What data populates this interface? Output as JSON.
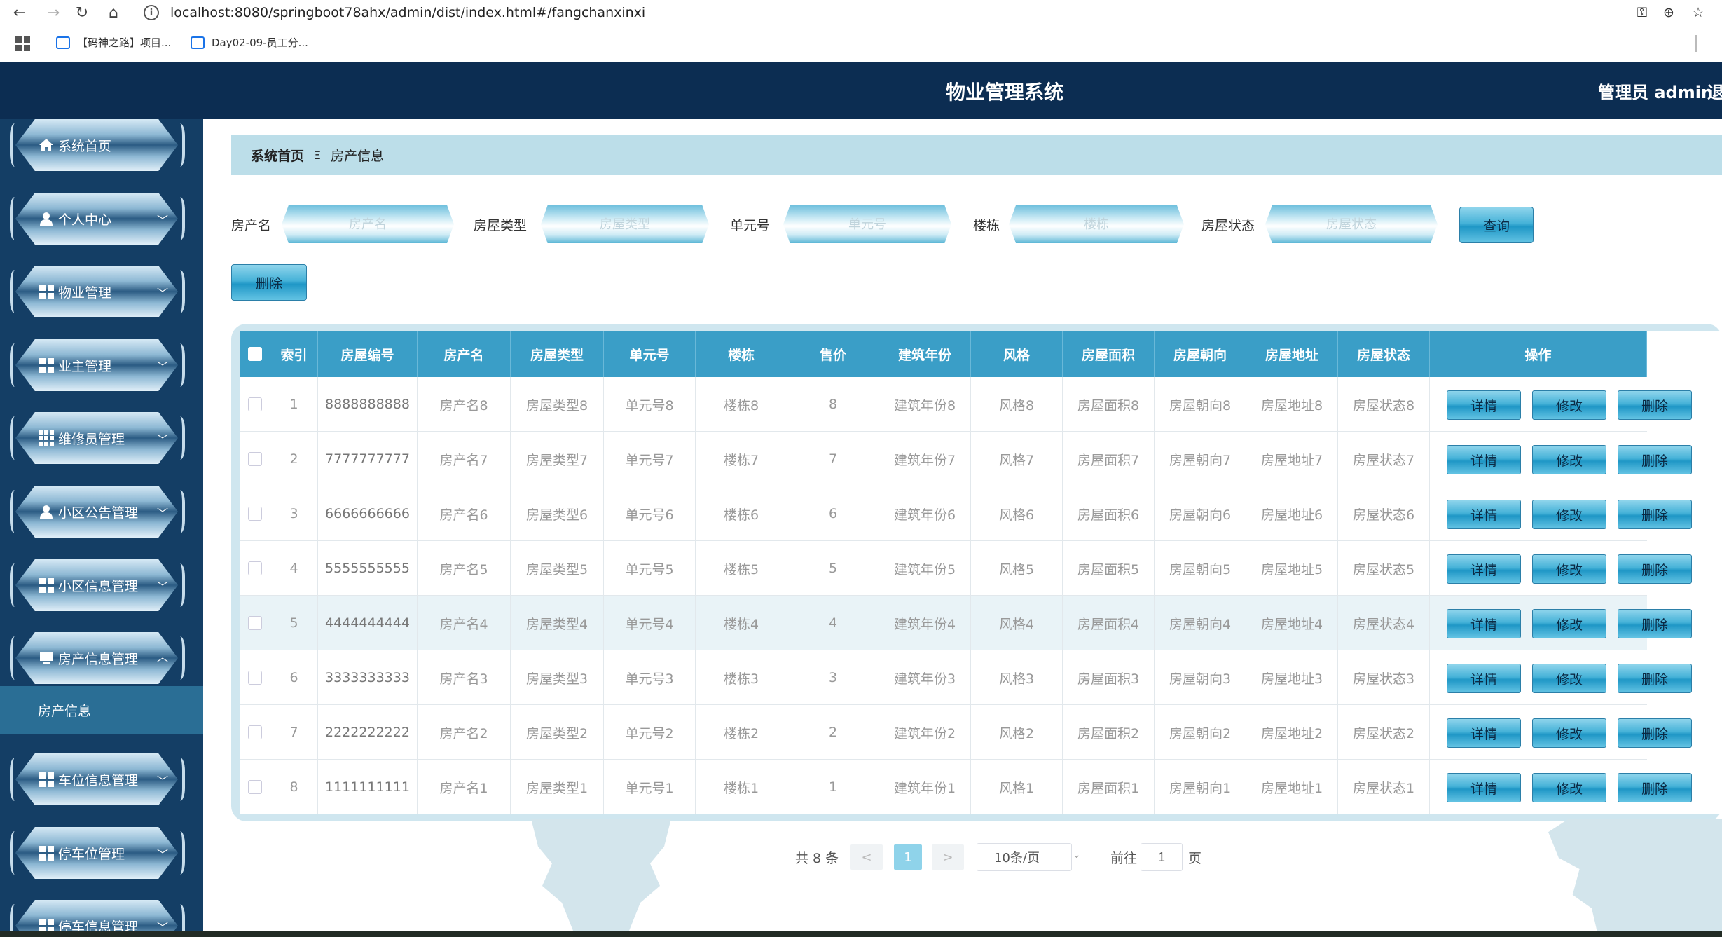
{
  "browser": {
    "url": "localhost:8080/springboot78ahx/admin/dist/index.html#/fangchanxinxi",
    "bookmarks": [
      "【码神之路】项目...",
      "Day02-09-员工分..."
    ]
  },
  "header": {
    "title": "物业管理系统",
    "user": "管理员 admin",
    "logout": "退"
  },
  "sidebar": {
    "items": [
      {
        "label": "系统首页",
        "icon": "home-icon"
      },
      {
        "label": "个人中心",
        "icon": "user-icon"
      },
      {
        "label": "物业管理",
        "icon": "grid-icon"
      },
      {
        "label": "业主管理",
        "icon": "grid-icon"
      },
      {
        "label": "维修员管理",
        "icon": "grid-icon"
      },
      {
        "label": "小区公告管理",
        "icon": "user-icon"
      },
      {
        "label": "小区信息管理",
        "icon": "grid-icon"
      },
      {
        "label": "房产信息管理",
        "icon": "monitor-icon"
      },
      {
        "label": "车位信息管理",
        "icon": "grid-icon"
      },
      {
        "label": "停车位管理",
        "icon": "grid-icon"
      },
      {
        "label": "停车信息管理",
        "icon": "grid-icon"
      }
    ],
    "active_sub": "房产信息"
  },
  "breadcrumb": {
    "home": "系统首页",
    "separator": "Ξ",
    "current": "房产信息"
  },
  "search": {
    "fields": [
      {
        "label": "房产名",
        "placeholder": "房产名"
      },
      {
        "label": "房屋类型",
        "placeholder": "房屋类型"
      },
      {
        "label": "单元号",
        "placeholder": "单元号"
      },
      {
        "label": "楼栋",
        "placeholder": "楼栋"
      },
      {
        "label": "房屋状态",
        "placeholder": "房屋状态"
      }
    ],
    "query_button": "查询",
    "delete_button": "删除"
  },
  "table": {
    "headers": [
      "索引",
      "房屋编号",
      "房产名",
      "房屋类型",
      "单元号",
      "楼栋",
      "售价",
      "建筑年份",
      "风格",
      "房屋面积",
      "房屋朝向",
      "房屋地址",
      "房屋状态",
      "操作"
    ],
    "actions": [
      "详情",
      "修改",
      "删除"
    ],
    "rows": [
      [
        "1",
        "8888888888",
        "房产名8",
        "房屋类型8",
        "单元号8",
        "楼栋8",
        "8",
        "建筑年份8",
        "风格8",
        "房屋面积8",
        "房屋朝向8",
        "房屋地址8",
        "房屋状态8"
      ],
      [
        "2",
        "7777777777",
        "房产名7",
        "房屋类型7",
        "单元号7",
        "楼栋7",
        "7",
        "建筑年份7",
        "风格7",
        "房屋面积7",
        "房屋朝向7",
        "房屋地址7",
        "房屋状态7"
      ],
      [
        "3",
        "6666666666",
        "房产名6",
        "房屋类型6",
        "单元号6",
        "楼栋6",
        "6",
        "建筑年份6",
        "风格6",
        "房屋面积6",
        "房屋朝向6",
        "房屋地址6",
        "房屋状态6"
      ],
      [
        "4",
        "5555555555",
        "房产名5",
        "房屋类型5",
        "单元号5",
        "楼栋5",
        "5",
        "建筑年份5",
        "风格5",
        "房屋面积5",
        "房屋朝向5",
        "房屋地址5",
        "房屋状态5"
      ],
      [
        "5",
        "4444444444",
        "房产名4",
        "房屋类型4",
        "单元号4",
        "楼栋4",
        "4",
        "建筑年份4",
        "风格4",
        "房屋面积4",
        "房屋朝向4",
        "房屋地址4",
        "房屋状态4"
      ],
      [
        "6",
        "3333333333",
        "房产名3",
        "房屋类型3",
        "单元号3",
        "楼栋3",
        "3",
        "建筑年份3",
        "风格3",
        "房屋面积3",
        "房屋朝向3",
        "房屋地址3",
        "房屋状态3"
      ],
      [
        "7",
        "2222222222",
        "房产名2",
        "房屋类型2",
        "单元号2",
        "楼栋2",
        "2",
        "建筑年份2",
        "风格2",
        "房屋面积2",
        "房屋朝向2",
        "房屋地址2",
        "房屋状态2"
      ],
      [
        "8",
        "1111111111",
        "房产名1",
        "房屋类型1",
        "单元号1",
        "楼栋1",
        "1",
        "建筑年份1",
        "风格1",
        "房屋面积1",
        "房屋朝向1",
        "房屋地址1",
        "房屋状态1"
      ]
    ]
  },
  "pagination": {
    "total": "共 8 条",
    "prev": "<",
    "current": "1",
    "next": ">",
    "page_size": "10条/页",
    "goto_label": "前往",
    "goto_value": "1",
    "page_suffix": "页"
  },
  "colors": {
    "header_bg": "#0c2d52",
    "sidebar_bg": "#143e65",
    "accent": "#3a9ec7"
  }
}
